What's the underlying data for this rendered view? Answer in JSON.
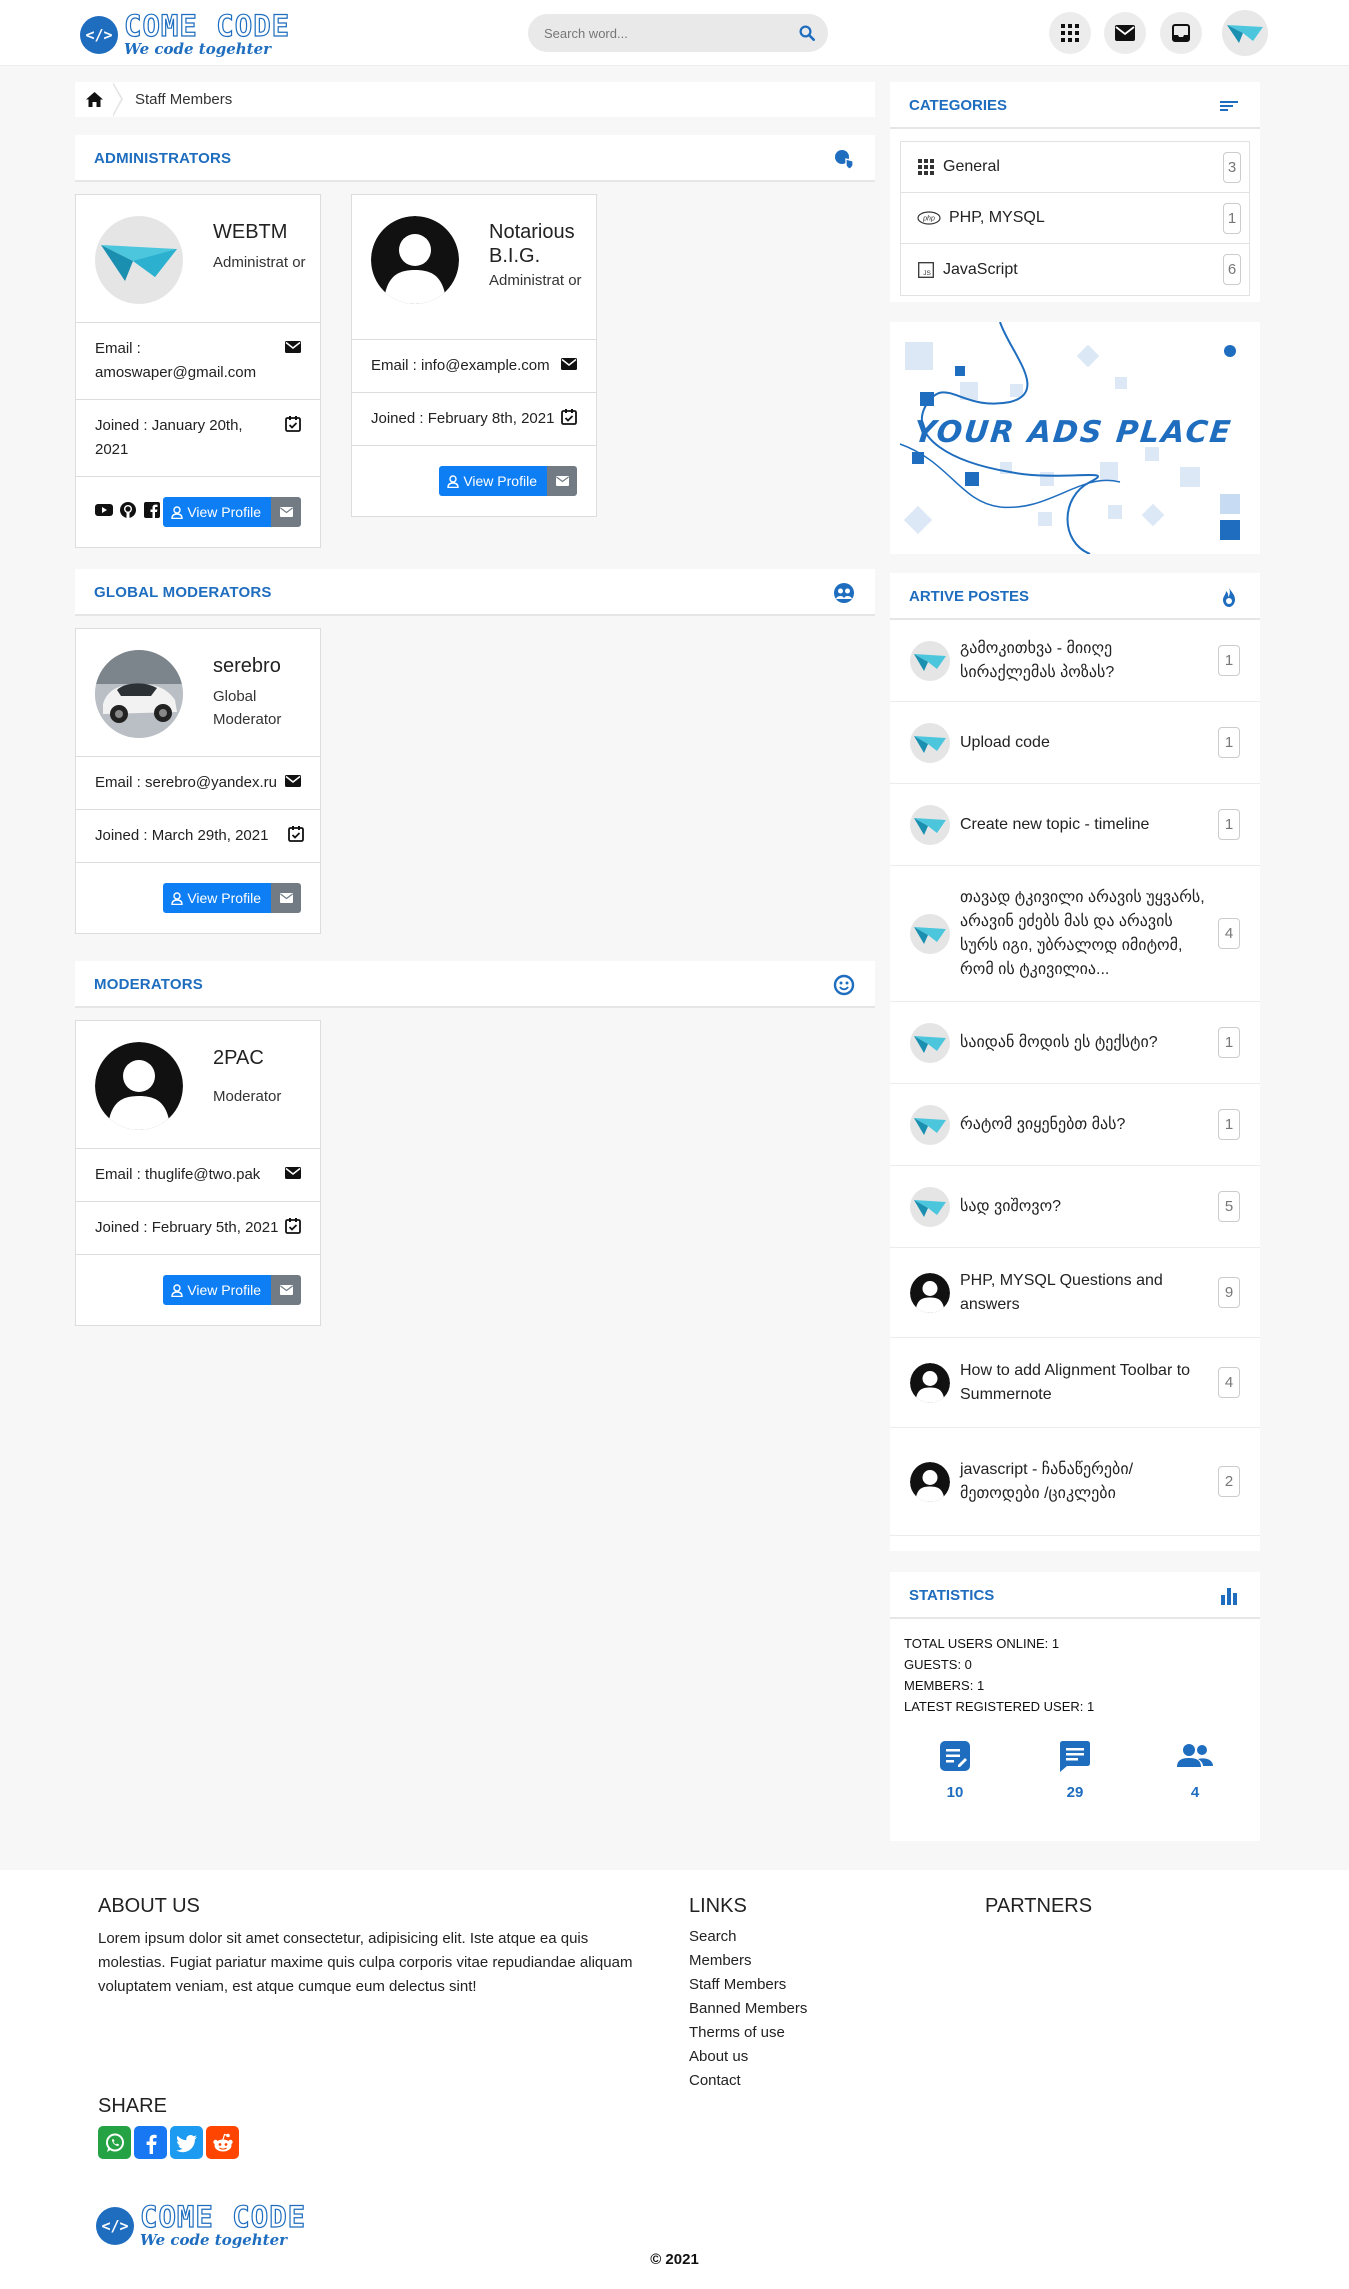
{
  "header": {
    "logo_title": "COME CODE",
    "logo_sub": "We code togehter",
    "search_placeholder": "Search word..."
  },
  "breadcrumb": {
    "current": "Staff Members"
  },
  "sections": {
    "administrators": "ADMINISTRATORS",
    "global_moderators": "GLOBAL MODERATORS",
    "moderators": "MODERATORS"
  },
  "staff": {
    "admin1": {
      "name": "WEBTM",
      "role": "Administrat or",
      "email": "Email : amoswaper@gmail.com",
      "joined": "Joined : January 20th, 2021"
    },
    "admin2": {
      "name": "Notarious B.I.G.",
      "role": "Administrat or",
      "email": "Email : info@example.com",
      "joined": "Joined : February 8th, 2021"
    },
    "gmod1": {
      "name": "serebro",
      "role": "Global Moderator",
      "email": "Email : serebro@yandex.ru",
      "joined": "Joined : March 29th, 2021"
    },
    "mod1": {
      "name": "2PAC",
      "role": "Moderator",
      "email": "Email : thuglife@two.pak",
      "joined": "Joined : February 5th, 2021"
    },
    "view_profile": "View Profile"
  },
  "sidebar": {
    "categories_title": "CATEGORIES",
    "categories": [
      {
        "name": "General",
        "count": "3",
        "icon": "grid-icon"
      },
      {
        "name": "PHP, MYSQL",
        "count": "1",
        "icon": "php-icon"
      },
      {
        "name": "JavaScript",
        "count": "6",
        "icon": "js-icon"
      }
    ],
    "ads_text": "YOUR ADS PLACE",
    "active_title": "ARTIVE POSTES",
    "posts": [
      {
        "title": "გამოკითხვა - მიიღე სირაქლემას პოზას?",
        "count": "1"
      },
      {
        "title": "Upload code",
        "count": "1"
      },
      {
        "title": "Create new topic - timeline",
        "count": "1"
      },
      {
        "title": "თავად ტკივილი არავის უყვარს, არავინ ეძებს მას და არავის სურს იგი, უბრალოდ იმიტომ, რომ ის ტკივილია...",
        "count": "4"
      },
      {
        "title": "საიდან მოდის ეს ტექსტი?",
        "count": "1"
      },
      {
        "title": "რატომ ვიყენებთ მას?",
        "count": "1"
      },
      {
        "title": "სად ვიშოვო?",
        "count": "5"
      },
      {
        "title": "PHP, MYSQL Questions and answers",
        "count": "9"
      },
      {
        "title": "How to add Alignment Toolbar to Summernote",
        "count": "4"
      },
      {
        "title": "javascript - ჩანაწერები/მეთოდები /ციკლები",
        "count": "2"
      }
    ],
    "stats_title": "STATISTICS",
    "stats_lines": [
      "TOTAL USERS ONLINE: 1",
      "GUESTS: 0",
      "MEMBERS: 1",
      "LATEST REGISTERED USER: 1"
    ],
    "stat_values": [
      "10",
      "29",
      "4"
    ]
  },
  "footer": {
    "about_title": "ABOUT US",
    "about_text": "Lorem ipsum dolor sit amet consectetur, adipisicing elit. Iste atque ea quis molestias. Fugiat pariatur maxime quis culpa corporis vitae repudiandae aliquam voluptatem veniam, est atque cumque eum delectus sint!",
    "links_title": "LINKS",
    "links": [
      "Search",
      "Members",
      "Staff Members",
      "Banned Members",
      "Therms of use",
      "About us",
      "Contact"
    ],
    "partners_title": "PARTNERS",
    "share_title": "SHARE",
    "logo_title": "COME CODE",
    "logo_sub": "We code togehter",
    "copyright": "© 2021"
  },
  "colors": {
    "accent": "#1e6dbf",
    "button": "#0d7ef4",
    "button_gray": "#727b83"
  }
}
